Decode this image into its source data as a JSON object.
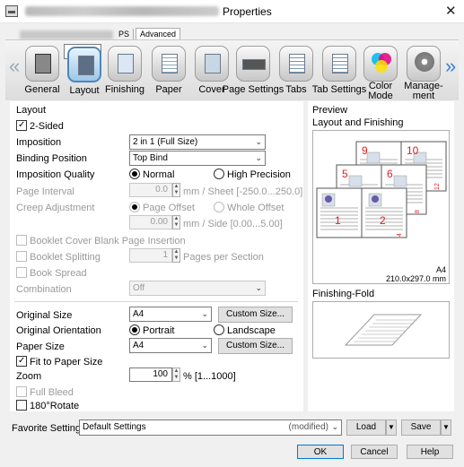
{
  "window": {
    "title": "Properties",
    "close_glyph": "✕"
  },
  "top_tabs": [
    {
      "label": "PS"
    },
    {
      "label": "Advanced"
    }
  ],
  "ribbon": {
    "items": [
      {
        "label": "General",
        "icon": "printer-icon"
      },
      {
        "label": "Layout",
        "icon": "layout-icon"
      },
      {
        "label": "Finishing",
        "icon": "finishing-icon"
      },
      {
        "label": "Paper",
        "icon": "paper-icon"
      },
      {
        "label": "Cover",
        "icon": "cover-icon"
      },
      {
        "label": "Page Settings",
        "icon": "page-settings-icon"
      },
      {
        "label": "Tabs",
        "icon": "tabs-icon"
      },
      {
        "label": "Tab Settings",
        "icon": "tab-settings-icon"
      },
      {
        "label": "Color Mode",
        "label1": "Color",
        "label2": "Mode",
        "icon": "color-mode-icon"
      },
      {
        "label": "Management",
        "label1": "Manage-",
        "label2": "ment",
        "icon": "management-icon"
      }
    ],
    "left_arrow": "«",
    "right_arrow": "»"
  },
  "layout": {
    "group_title": "Layout",
    "two_sided": {
      "label": "2-Sided",
      "checked": true
    },
    "imposition": {
      "label": "Imposition",
      "value": "2 in 1 (Full Size)"
    },
    "binding_position": {
      "label": "Binding Position",
      "value": "Top Bind"
    },
    "imposition_quality": {
      "label": "Imposition Quality",
      "options": [
        "Normal",
        "High Precision"
      ],
      "selected": "Normal"
    },
    "page_interval": {
      "label": "Page Interval",
      "value": "0.0",
      "unit": "mm / Sheet [-250.0...250.0]"
    },
    "creep_adjustment": {
      "label": "Creep Adjustment",
      "options": [
        "Page Offset",
        "Whole Offset"
      ],
      "selected": "Page Offset",
      "value": "0.00",
      "unit": "mm / Side [0.00...5.00]"
    },
    "booklet_cover_blank": {
      "label": "Booklet Cover Blank Page Insertion"
    },
    "booklet_splitting": {
      "label": "Booklet Splitting",
      "value": "1",
      "unit": "Pages per Section"
    },
    "book_spread": {
      "label": "Book Spread"
    },
    "combination": {
      "label": "Combination",
      "value": "Off"
    }
  },
  "original": {
    "original_size": {
      "label": "Original Size",
      "value": "A4",
      "button": "Custom Size..."
    },
    "orientation": {
      "label": "Original Orientation",
      "options": [
        "Portrait",
        "Landscape"
      ],
      "selected": "Portrait"
    },
    "paper_size": {
      "label": "Paper Size",
      "value": "A4",
      "button": "Custom Size..."
    },
    "fit_to_paper": {
      "label": "Fit to Paper Size",
      "checked": true
    },
    "zoom": {
      "label": "Zoom",
      "value": "100",
      "unit": "% [1...1000]"
    },
    "full_bleed": {
      "label": "Full Bleed"
    },
    "rotate180": {
      "label": "180°Rotate",
      "checked": false
    }
  },
  "preview": {
    "group_title": "Preview",
    "layout_finishing_label": "Layout and Finishing",
    "pages": [
      "9",
      "10",
      "5",
      "6",
      "1",
      "2"
    ],
    "edge_numbers": [
      "12",
      "8",
      "4"
    ],
    "paper_name": "A4",
    "paper_dims": "210.0x297.0 mm",
    "finishing_fold_label": "Finishing-Fold",
    "colors": {
      "page_number": "#e02020",
      "accent": "#0078d7"
    }
  },
  "favorite": {
    "label": "Favorite Setting",
    "value": "Default Settings",
    "modified": "(modified)",
    "load": "Load",
    "save": "Save"
  },
  "footer": {
    "ok": "OK",
    "cancel": "Cancel",
    "help": "Help"
  }
}
